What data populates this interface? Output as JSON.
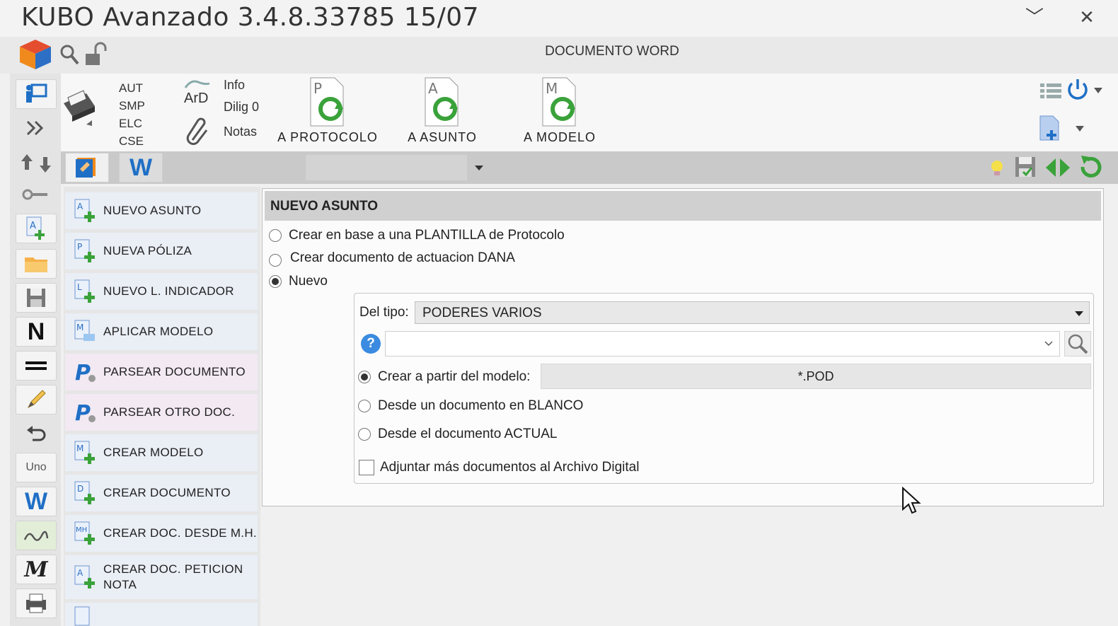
{
  "window": {
    "title": "KUBO Avanzado 3.4.8.33785   15/07",
    "minimize_glyph": "﹀",
    "close_glyph": "✕"
  },
  "header": {
    "doc_title": "DOCUMENTO WORD"
  },
  "ribbon": {
    "codes": [
      "AUT",
      "SMP",
      "ELC",
      "CSE"
    ],
    "ard_label": "ArD",
    "links": [
      "Info",
      "Dilig 0",
      "Notas"
    ],
    "big_buttons": [
      {
        "letter": "P",
        "label": "A PROTOCOLO"
      },
      {
        "letter": "A",
        "label": "A ASUNTO"
      },
      {
        "letter": "M",
        "label": "A MODELO"
      }
    ]
  },
  "left_strip": {
    "n_label": "N",
    "uno_label": "Uno",
    "w_label": "W",
    "m_label": "M"
  },
  "tabs": {
    "word_tab": "W"
  },
  "side_menu": [
    {
      "letter": "A",
      "label": "NUEVO ASUNTO"
    },
    {
      "letter": "P",
      "label": "NUEVA PÓLIZA"
    },
    {
      "letter": "L",
      "label": "NUEVO L. INDICADOR"
    },
    {
      "letter": "M",
      "label": "APLICAR MODELO"
    },
    {
      "letter": "P",
      "label": "PARSEAR DOCUMENTO"
    },
    {
      "letter": "P",
      "label": "PARSEAR OTRO DOC."
    },
    {
      "letter": "M",
      "label": "CREAR MODELO"
    },
    {
      "letter": "D",
      "label": "CREAR DOCUMENTO"
    },
    {
      "letter": "MH",
      "label": "CREAR DOC. DESDE M.H."
    },
    {
      "letter": "A",
      "label": "CREAR DOC. PETICION NOTA"
    }
  ],
  "panel": {
    "title": "NUEVO ASUNTO",
    "options": [
      {
        "label": "Crear en base a una PLANTILLA de Protocolo",
        "selected": false
      },
      {
        "label": "Crear documento de actuacion DANA",
        "selected": false
      },
      {
        "label": "Nuevo",
        "selected": true
      }
    ],
    "tipo_label": "Del tipo:",
    "tipo_value": "PODERES VARIOS",
    "search_value": "",
    "help_glyph": "?",
    "sub_options": [
      {
        "label": "Crear a partir del modelo:",
        "selected": true
      },
      {
        "label": "Desde un documento en BLANCO",
        "selected": false
      },
      {
        "label": "Desde el documento ACTUAL",
        "selected": false
      }
    ],
    "modelo_value": "*.POD",
    "attach_label": "Adjuntar más documentos al Archivo Digital",
    "attach_checked": false
  },
  "colors": {
    "accent_blue": "#1f6fc6",
    "green": "#3aa23a",
    "menu_bg": "#eaeef5"
  }
}
